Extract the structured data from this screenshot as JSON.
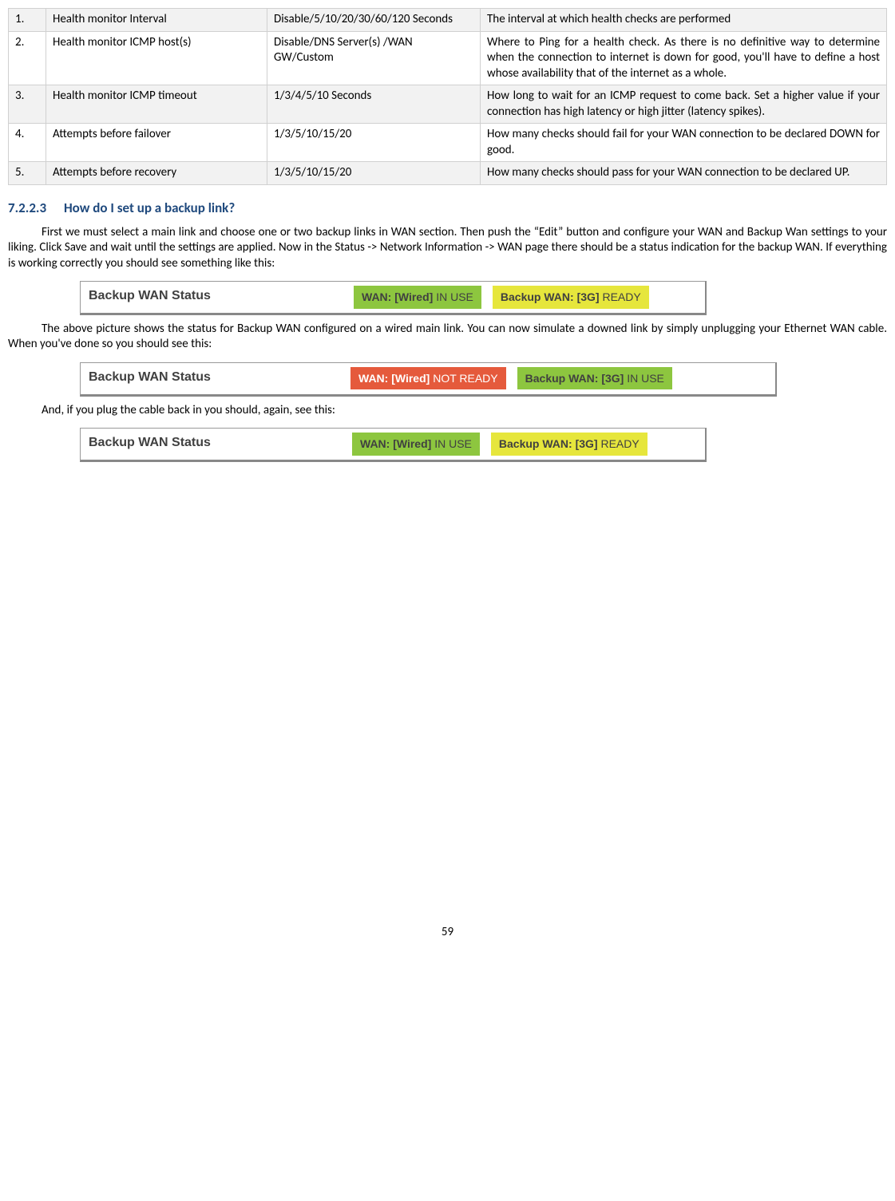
{
  "table": {
    "rows": [
      {
        "n": "1.",
        "name": "Health monitor Interval",
        "opts": "Disable/5/10/20/30/60/120 Seconds",
        "desc": "The interval at which health checks are performed"
      },
      {
        "n": "2.",
        "name": "Health monitor ICMP host(s)",
        "opts": "Disable/DNS Server(s) /WAN GW/Custom",
        "desc": "Where to Ping for a health check. As there is no definitive way to determine when the connection to internet is down for good, you'll have to define a host whose availability that of the internet as a whole."
      },
      {
        "n": "3.",
        "name": "Health monitor ICMP timeout",
        "opts": "1/3/4/5/10 Seconds",
        "desc": "How long to wait for an ICMP request to come back. Set a higher value if your connection has high latency or high jitter (latency spikes)."
      },
      {
        "n": "4.",
        "name": "Attempts before failover",
        "opts": "1/3/5/10/15/20",
        "desc": "How many checks should fail for your WAN connection to be declared DOWN for good."
      },
      {
        "n": "5.",
        "name": "Attempts before recovery",
        "opts": "1/3/5/10/15/20",
        "desc": "How many checks should pass for your WAN connection to be declared UP."
      }
    ]
  },
  "heading": {
    "num": "7.2.2.3",
    "text": "How do I set up a backup link?"
  },
  "para1": "First we must select a main link and choose one or two backup links in WAN section. Then push the “Edit” button and configure your WAN and Backup Wan settings to your liking. Click Save and wait until the settings are applied. Now in the Status -> Network Information -> WAN page there should be a status indication for the backup WAN. If everything is working correctly you should see something like this:",
  "para2": "The above picture shows the status for Backup WAN configured on a wired main link. You can now simulate a downed link by simply unplugging your Ethernet WAN cable. When you've done so you should see this:",
  "para3": "And, if you plug the cable back in you should, again, see this:",
  "ss_title": "Backup WAN Status",
  "pills": {
    "wan_inuse": {
      "lbl": "WAN: [Wired]",
      "state": "IN USE"
    },
    "wan_notready": {
      "lbl": "WAN: [Wired]",
      "state": "NOT READY"
    },
    "bk_ready": {
      "lbl": "Backup WAN: [3G]",
      "state": "READY"
    },
    "bk_inuse": {
      "lbl": "Backup WAN: [3G]",
      "state": "IN USE"
    }
  },
  "page": "59"
}
